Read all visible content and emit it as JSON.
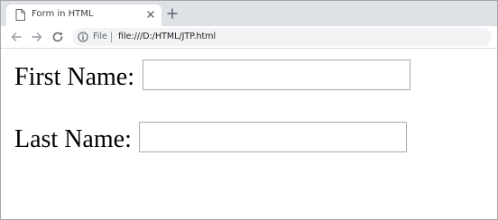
{
  "browser": {
    "tab": {
      "title": "Form in HTML",
      "icon": "page-icon",
      "close_icon": "close-icon"
    },
    "new_tab_icon": "plus-icon",
    "toolbar": {
      "back_icon": "arrow-left-icon",
      "forward_icon": "arrow-right-icon",
      "reload_icon": "reload-icon",
      "info_icon": "info-icon",
      "scheme_label": "File",
      "url": "file:///D:/HTML/JTP.html"
    }
  },
  "form": {
    "first_name": {
      "label": "First Name:",
      "value": "",
      "placeholder": ""
    },
    "last_name": {
      "label": "Last Name:",
      "value": "",
      "placeholder": ""
    }
  },
  "colors": {
    "tab_strip": "#dee1e6",
    "omnibox": "#f1f3f4",
    "input_border": "#a9a9a9"
  }
}
